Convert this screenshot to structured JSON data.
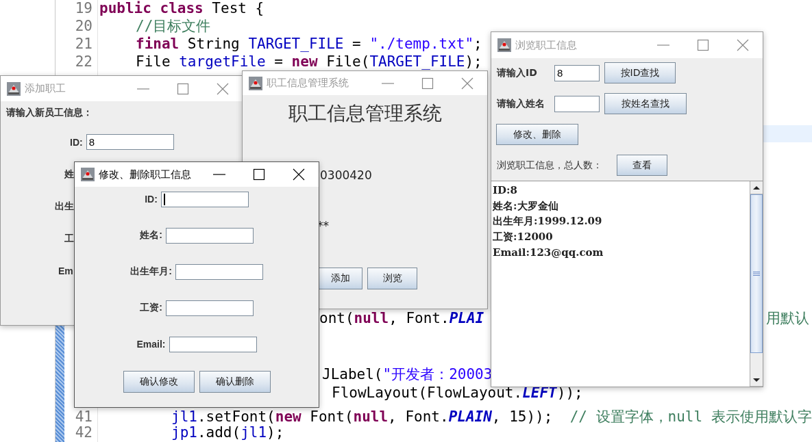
{
  "editor": {
    "line_numbers": [
      "19",
      "20",
      "21",
      "22",
      "41",
      "42"
    ],
    "lines": [
      {
        "segments": [
          {
            "kind": "keyword",
            "text": "public class"
          },
          {
            "kind": "plain",
            "text": " Test {"
          }
        ]
      },
      {
        "segments": [
          {
            "kind": "comment",
            "text": "//目标文件"
          }
        ]
      },
      {
        "segments": [
          {
            "kind": "keyword",
            "text": "final"
          },
          {
            "kind": "plain",
            "text": " String "
          },
          {
            "kind": "field",
            "text": "TARGET_FILE"
          },
          {
            "kind": "plain",
            "text": " = "
          },
          {
            "kind": "string",
            "text": "\"./temp.txt\""
          },
          {
            "kind": "plain",
            "text": ";"
          }
        ]
      },
      {
        "segments": [
          {
            "kind": "plain",
            "text": "File "
          },
          {
            "kind": "field",
            "text": "targetFile"
          },
          {
            "kind": "plain",
            "text": " = "
          },
          {
            "kind": "keyword",
            "text": "new"
          },
          {
            "kind": "plain",
            "text": " File("
          },
          {
            "kind": "field",
            "text": "TARGET_FILE"
          },
          {
            "kind": "plain",
            "text": ");"
          }
        ]
      },
      {
        "segments": [
          {
            "kind": "plain",
            "text": "ont("
          },
          {
            "kind": "keyword",
            "text": "null"
          },
          {
            "kind": "plain",
            "text": ", Font."
          },
          {
            "kind": "constant",
            "text": "PLAI"
          }
        ]
      },
      {
        "segments": [
          {
            "kind": "comment",
            "text": "用默认"
          }
        ]
      },
      {
        "segments": [
          {
            "kind": "plain",
            "text": "JLabel("
          },
          {
            "kind": "string",
            "text": "\"开发者：20003"
          }
        ]
      },
      {
        "segments": [
          {
            "kind": "plain",
            "text": "FlowLayout(FlowLayout."
          },
          {
            "kind": "constant",
            "text": "LEFT"
          },
          {
            "kind": "plain",
            "text": "));"
          }
        ]
      },
      {
        "segments": [
          {
            "kind": "field",
            "text": "jl1"
          },
          {
            "kind": "plain",
            "text": ".setFont("
          },
          {
            "kind": "keyword",
            "text": "new"
          },
          {
            "kind": "plain",
            "text": " Font("
          },
          {
            "kind": "keyword",
            "text": "null"
          },
          {
            "kind": "plain",
            "text": ", Font."
          },
          {
            "kind": "constant",
            "text": "PLAIN"
          },
          {
            "kind": "plain",
            "text": ", 15));  "
          },
          {
            "kind": "comment",
            "text": "// 设置字体，null 表示使用默认字"
          }
        ]
      },
      {
        "segments": [
          {
            "kind": "field",
            "text": "jp1"
          },
          {
            "kind": "plain",
            "text": ".add("
          },
          {
            "kind": "field",
            "text": "jl1"
          },
          {
            "kind": "plain",
            "text": ");"
          }
        ]
      }
    ]
  },
  "windows": [
    {
      "kind": "add",
      "title": "添加职工",
      "active": false,
      "intro": "请输入新员工信息：",
      "fields": [
        {
          "label": "ID:",
          "value": "8"
        }
      ],
      "partial_labels": [
        "姓",
        "出生",
        "工",
        "Em"
      ]
    },
    {
      "kind": "main",
      "title": "职工信息管理系统",
      "active": false,
      "heading": "职工信息管理系统",
      "texts": [
        "0300420",
        "**"
      ],
      "buttons": [
        "添加",
        "浏览"
      ]
    },
    {
      "kind": "modify",
      "title": "修改、删除职工信息",
      "active": true,
      "fields": [
        {
          "label": "ID:",
          "focused": true
        },
        {
          "label": "姓名:",
          "focused": false
        },
        {
          "label": "出生年月:",
          "focused": false
        },
        {
          "label": "工资:",
          "focused": false
        },
        {
          "label": "Email:",
          "focused": false
        }
      ],
      "buttons": [
        "确认修改",
        "确认删除"
      ]
    },
    {
      "kind": "browse",
      "title": "浏览职工信息",
      "active": false,
      "search_rows": [
        {
          "label": "请输入ID",
          "value": "8",
          "button": "按ID查找"
        },
        {
          "label": "请输入姓名",
          "button": "按姓名查找"
        }
      ],
      "edit_button": "修改、删除",
      "count_label": "浏览职工信息，总人数：",
      "view_button": "查看",
      "output_lines": [
        "ID:8",
        "姓名:大罗金仙",
        "出生年月:1999.12.09",
        "工资:12000",
        "Email:123@qq.com"
      ]
    }
  ]
}
